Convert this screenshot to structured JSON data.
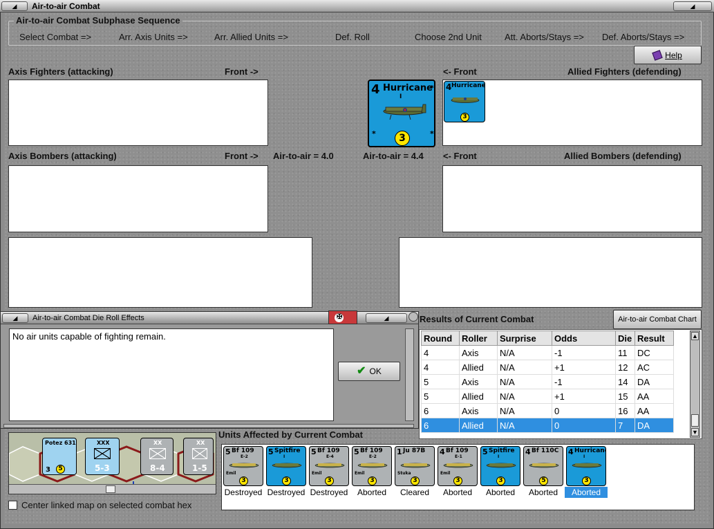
{
  "window": {
    "title": "Air-to-air Combat"
  },
  "sequence": {
    "title": "Air-to-air Combat Subphase Sequence",
    "steps": [
      "Select Combat =>",
      "Arr. Axis Units =>",
      "Arr. Allied Units =>",
      "Def. Roll",
      "Choose 2nd Unit",
      "Att. Aborts/Stays =>",
      "Def. Aborts/Stays =>"
    ]
  },
  "help_label": "Help",
  "axis_fighters": {
    "title": "Axis Fighters (attacking)",
    "front": "Front ->"
  },
  "allied_fighters": {
    "title": "Allied Fighters (defending)",
    "front": "<- Front"
  },
  "axis_bombers": {
    "title": "Axis Bombers (attacking)",
    "front": "Front ->"
  },
  "allied_bombers": {
    "title": "Allied Bombers (defending)",
    "front": "<- Front"
  },
  "axis_air_to_air": "Air-to-air = 4.0",
  "allied_air_to_air": "Air-to-air = 4.4",
  "selected_unit": {
    "name": "Hurricane",
    "sub": "I",
    "top_value": "4",
    "circle_value": "3"
  },
  "allied_fighter_unit": {
    "name": "Hurricane",
    "sub": "I",
    "top_value": "4",
    "circle_value": "3"
  },
  "dialog": {
    "title": "Air-to-air Combat Die Roll Effects",
    "message": "No air units capable of fighting remain.",
    "ok_label": "OK"
  },
  "results": {
    "title": "Results of Current Combat",
    "chart_button": "Air-to-air Combat Chart",
    "columns": [
      "Round",
      "Roller",
      "Surprise",
      "Odds",
      "Die",
      "Result"
    ],
    "rows": [
      [
        "4",
        "Axis",
        "N/A",
        "-1",
        "11",
        "DC"
      ],
      [
        "4",
        "Allied",
        "N/A",
        "+1",
        "12",
        "AC"
      ],
      [
        "5",
        "Axis",
        "N/A",
        "-1",
        "14",
        "DA"
      ],
      [
        "5",
        "Allied",
        "N/A",
        "+1",
        "15",
        "AA"
      ],
      [
        "6",
        "Axis",
        "N/A",
        "0",
        "16",
        "AA"
      ],
      [
        "6",
        "Allied",
        "N/A",
        "0",
        "7",
        "DA"
      ]
    ],
    "selected_row": 5
  },
  "affected": {
    "title": "Units Affected by Current Combat",
    "units": [
      {
        "name": "Bf 109",
        "sub": "E-2",
        "nick": "Emil",
        "left": "5",
        "circle": "3",
        "status": "Destroyed",
        "side": "axis"
      },
      {
        "name": "Spitfire",
        "sub": "I",
        "nick": "",
        "left": "5",
        "circle": "3",
        "status": "Destroyed",
        "side": "allied"
      },
      {
        "name": "Bf 109",
        "sub": "E-4",
        "nick": "Emil",
        "left": "5",
        "circle": "3",
        "status": "Destroyed",
        "side": "axis"
      },
      {
        "name": "Bf 109",
        "sub": "E-2",
        "nick": "Emil",
        "left": "5",
        "circle": "3",
        "status": "Aborted",
        "side": "axis"
      },
      {
        "name": "Ju 87B",
        "sub": "",
        "nick": "Stuka",
        "left": "1",
        "circle": "3",
        "status": "Cleared",
        "side": "axis"
      },
      {
        "name": "Bf 109",
        "sub": "E-1",
        "nick": "Emil",
        "left": "4",
        "circle": "3",
        "status": "Aborted",
        "side": "axis"
      },
      {
        "name": "Spitfire",
        "sub": "I",
        "nick": "",
        "left": "5",
        "circle": "3",
        "status": "Aborted",
        "side": "allied"
      },
      {
        "name": "Bf 110C",
        "sub": "",
        "nick": "",
        "left": "4",
        "circle": "5",
        "status": "Aborted",
        "side": "axis"
      },
      {
        "name": "Hurricane",
        "sub": "I",
        "nick": "",
        "left": "4",
        "circle": "3",
        "status": "Aborted",
        "side": "allied"
      }
    ],
    "selected_index": 8
  },
  "minimap": {
    "counters": [
      {
        "top": "Potez 631",
        "bottom": "3",
        "circle": "5"
      },
      {
        "top": "XXX",
        "bottom": "5-3"
      },
      {
        "top": "XX",
        "bottom": "8-4"
      },
      {
        "top": "XX",
        "bottom": "1-5"
      }
    ]
  },
  "center_map_label": "Center linked map on selected combat hex",
  "colors": {
    "allied_blue": "#1a9ad8",
    "axis_gray": "#aeb2b4",
    "selection": "#2f8fe0",
    "yellow_circle": "#ffe600"
  }
}
